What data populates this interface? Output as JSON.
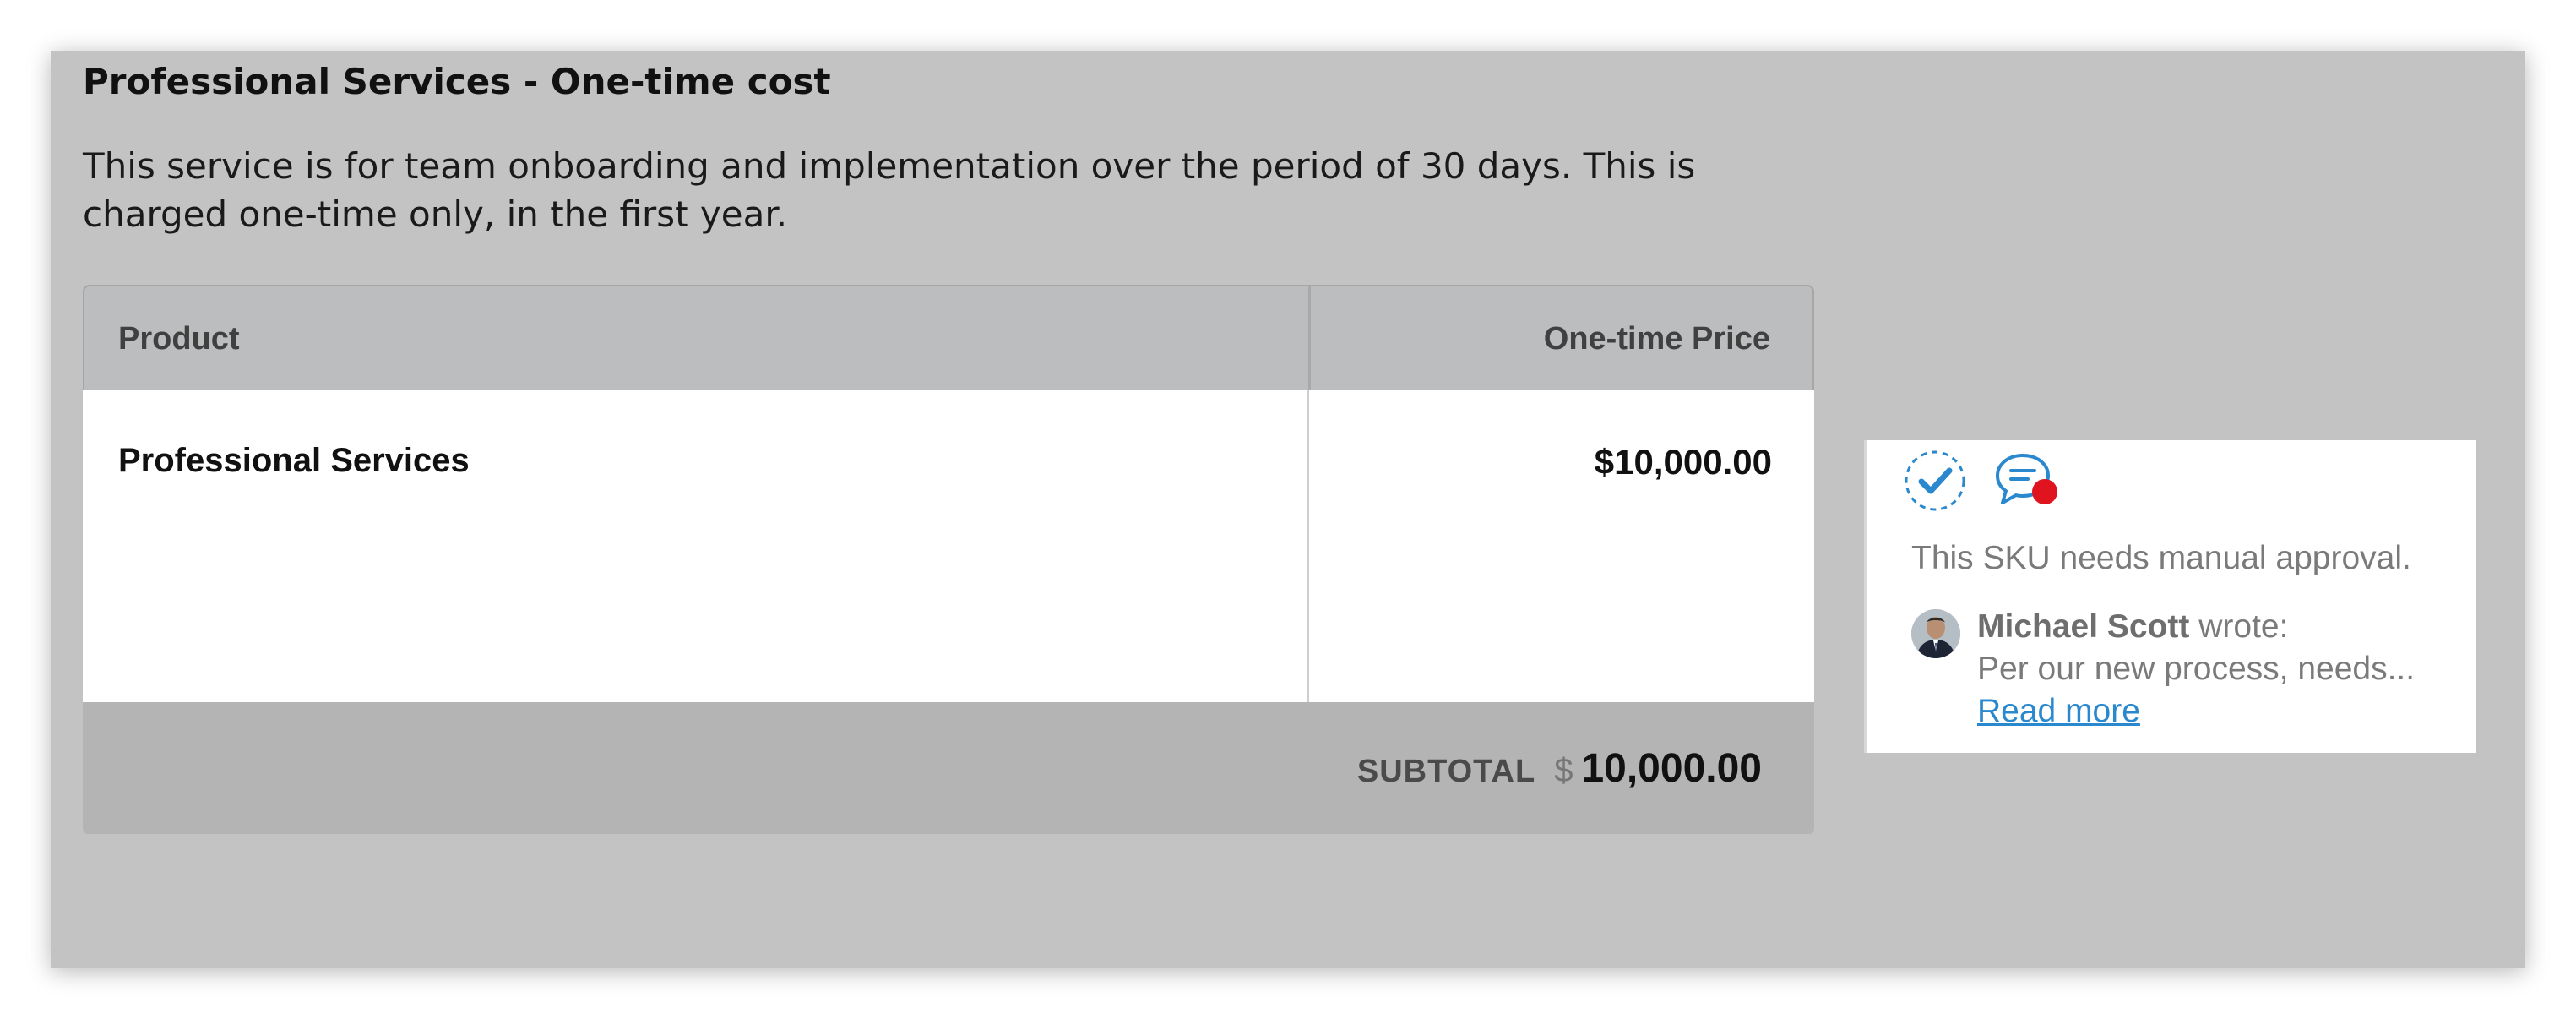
{
  "section": {
    "title": "Professional Services - One-time cost",
    "description": "This service is for team onboarding and implementation over the period of 30 days. This is charged one-time only, in the first year."
  },
  "table": {
    "headers": {
      "product": "Product",
      "price": "One-time Price"
    },
    "rows": [
      {
        "product": "Professional Services",
        "price": "$10,000.00"
      }
    ],
    "subtotal": {
      "label": "SUBTOTAL",
      "currency": "$",
      "amount": "10,000.00"
    }
  },
  "approval_note": {
    "icons": [
      "approve-check-icon",
      "comment-notification-icon"
    ],
    "message": "This SKU needs manual approval.",
    "comment": {
      "author": "Michael Scott",
      "verb": "wrote:",
      "excerpt": "Per our new process, needs...",
      "read_more": "Read more"
    }
  },
  "colors": {
    "panel_background": "#c3c3c3",
    "header_background": "#bcbdbf",
    "footer_background": "#b4b4b4",
    "accent_blue": "#2a88cf",
    "notification_red": "#e0141e"
  }
}
